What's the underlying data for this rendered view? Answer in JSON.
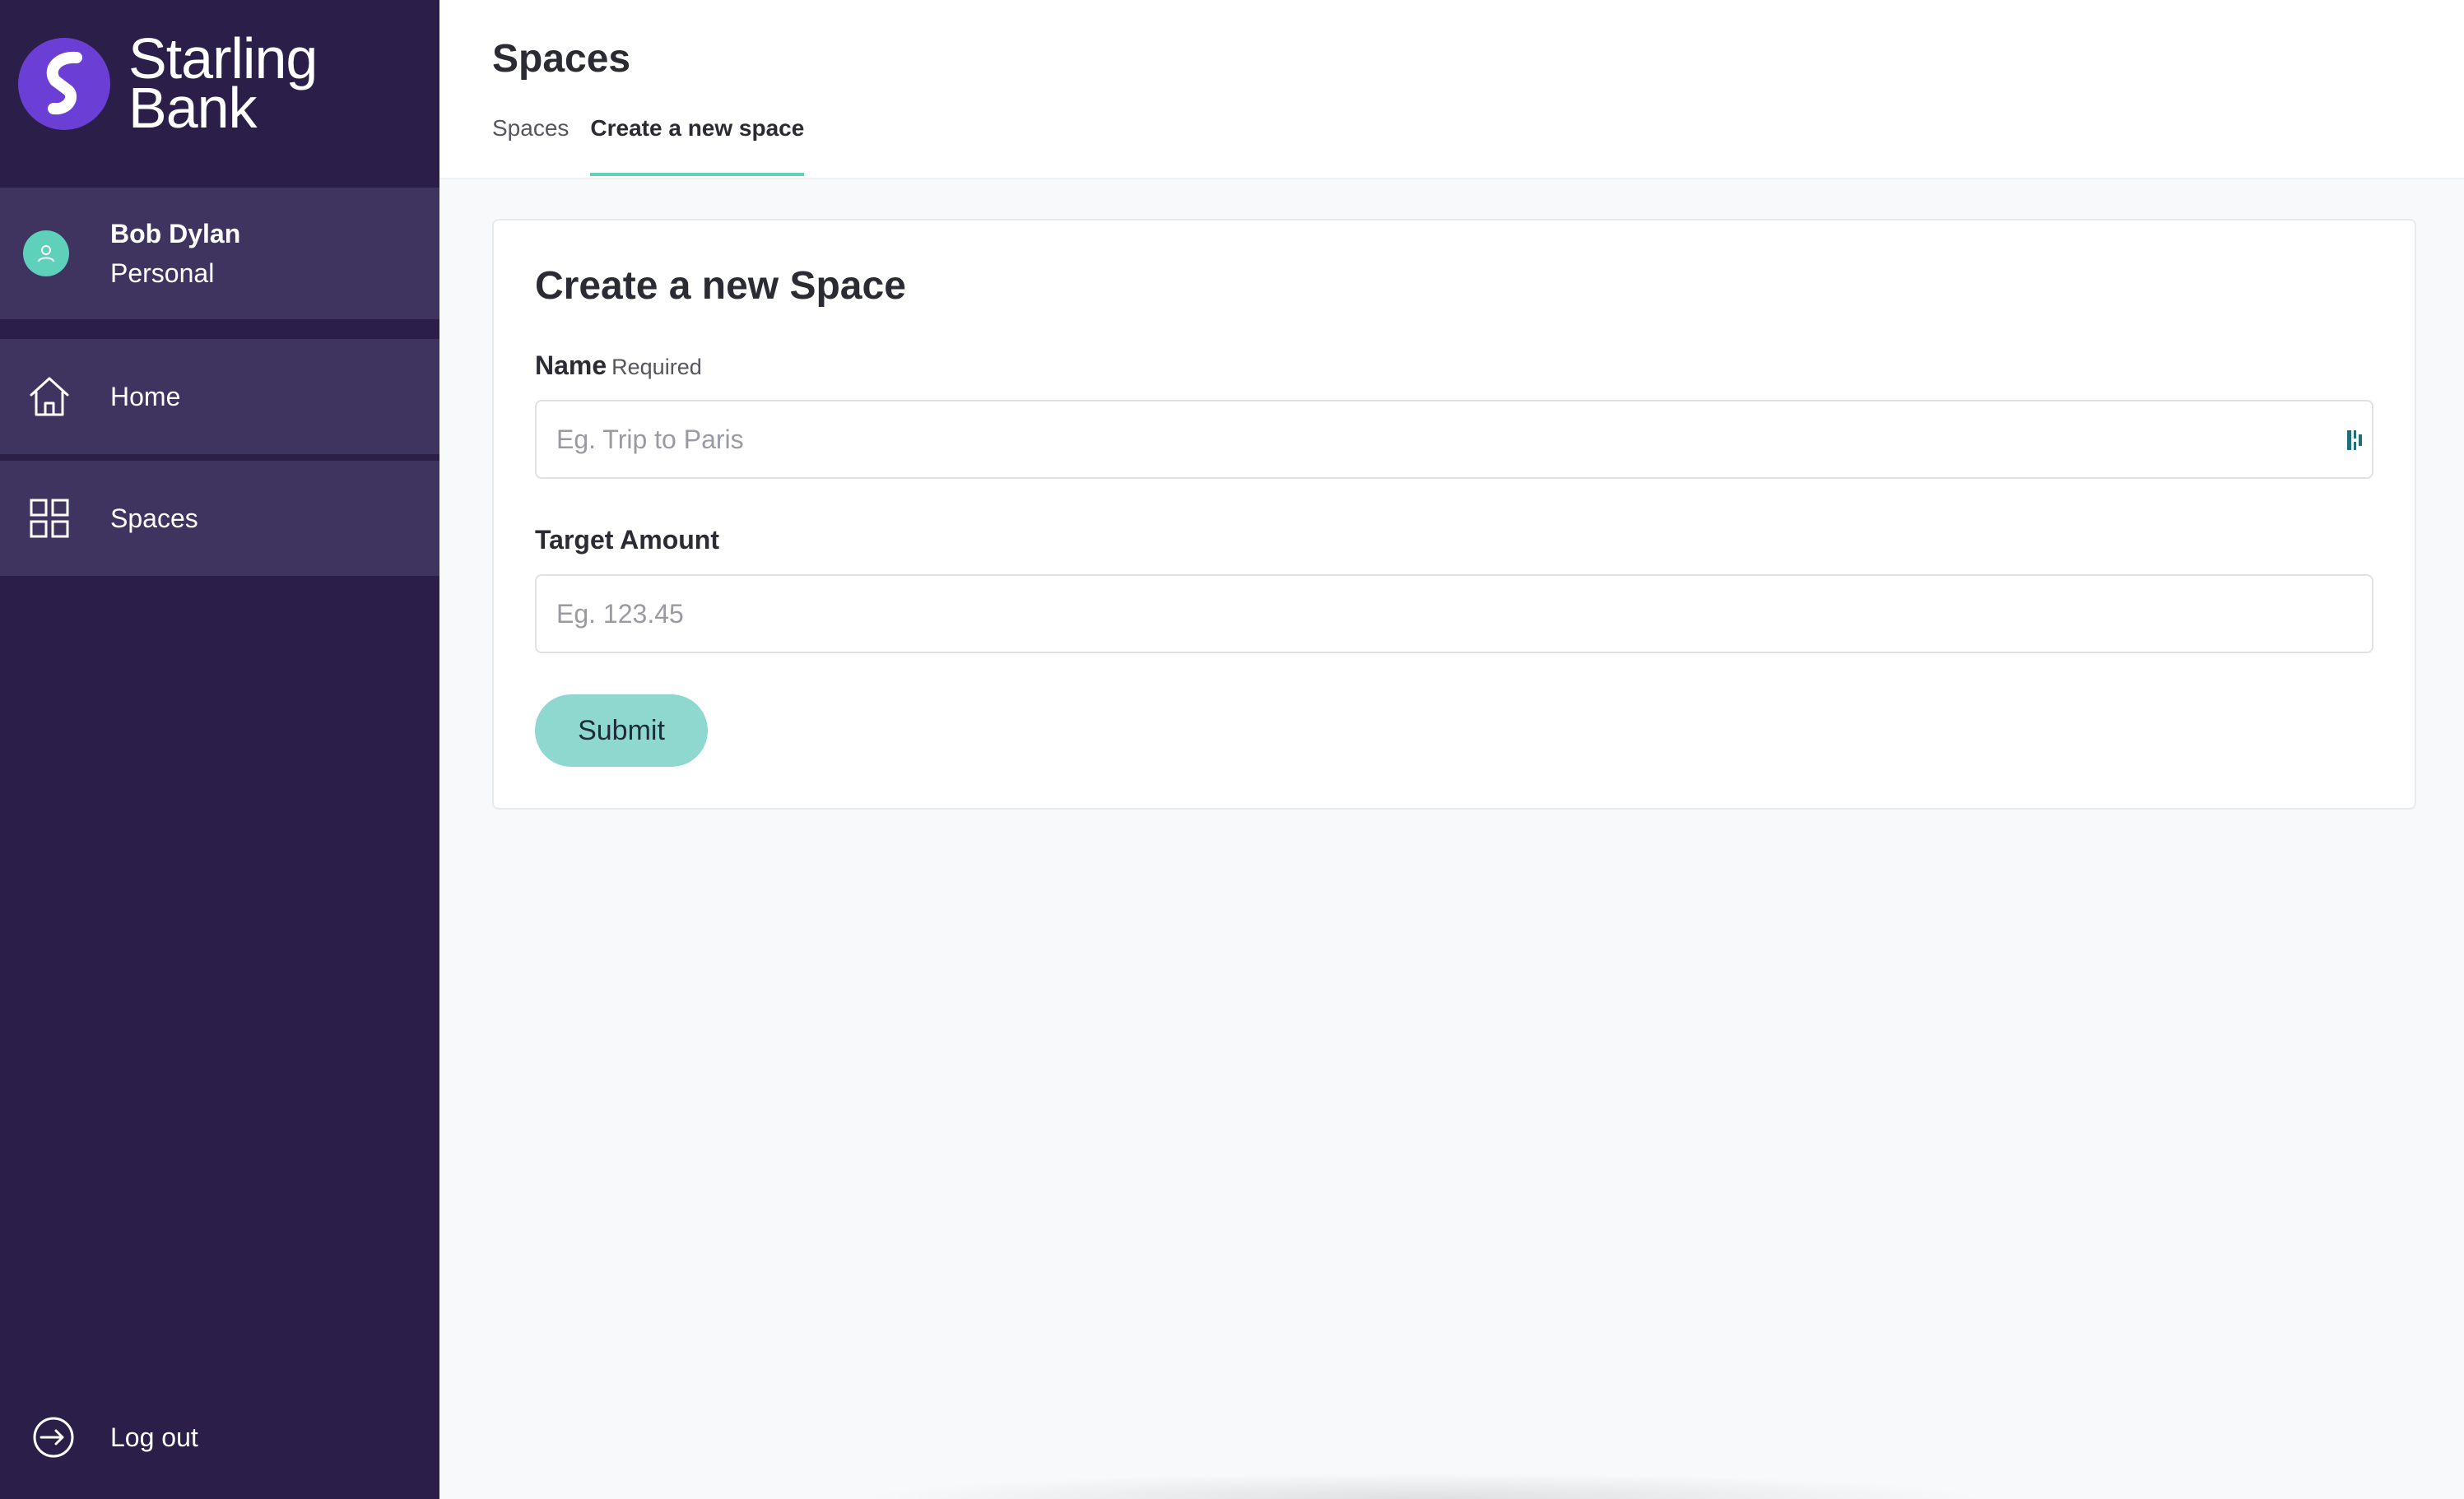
{
  "brand": {
    "line1": "Starling",
    "line2": "Bank",
    "color": "#6b3fd6"
  },
  "user": {
    "name": "Bob Dylan",
    "type": "Personal"
  },
  "sidebar": {
    "items": [
      {
        "label": "Home",
        "icon": "home-icon"
      },
      {
        "label": "Spaces",
        "icon": "grid-icon"
      }
    ],
    "logout_label": "Log out"
  },
  "header": {
    "title": "Spaces",
    "tabs": [
      {
        "label": "Spaces",
        "active": false
      },
      {
        "label": "Create a new space",
        "active": true
      }
    ]
  },
  "form": {
    "title": "Create a new Space",
    "name_label": "Name",
    "name_required": "Required",
    "name_placeholder": "Eg. Trip to Paris",
    "amount_label": "Target Amount",
    "amount_placeholder": "Eg. 123.45",
    "submit_label": "Submit"
  },
  "colors": {
    "sidebar_bg": "#2b1f4a",
    "nav_item_bg": "#3f3460",
    "accent": "#5fd0ba",
    "submit_bg": "#8ed8d0"
  }
}
